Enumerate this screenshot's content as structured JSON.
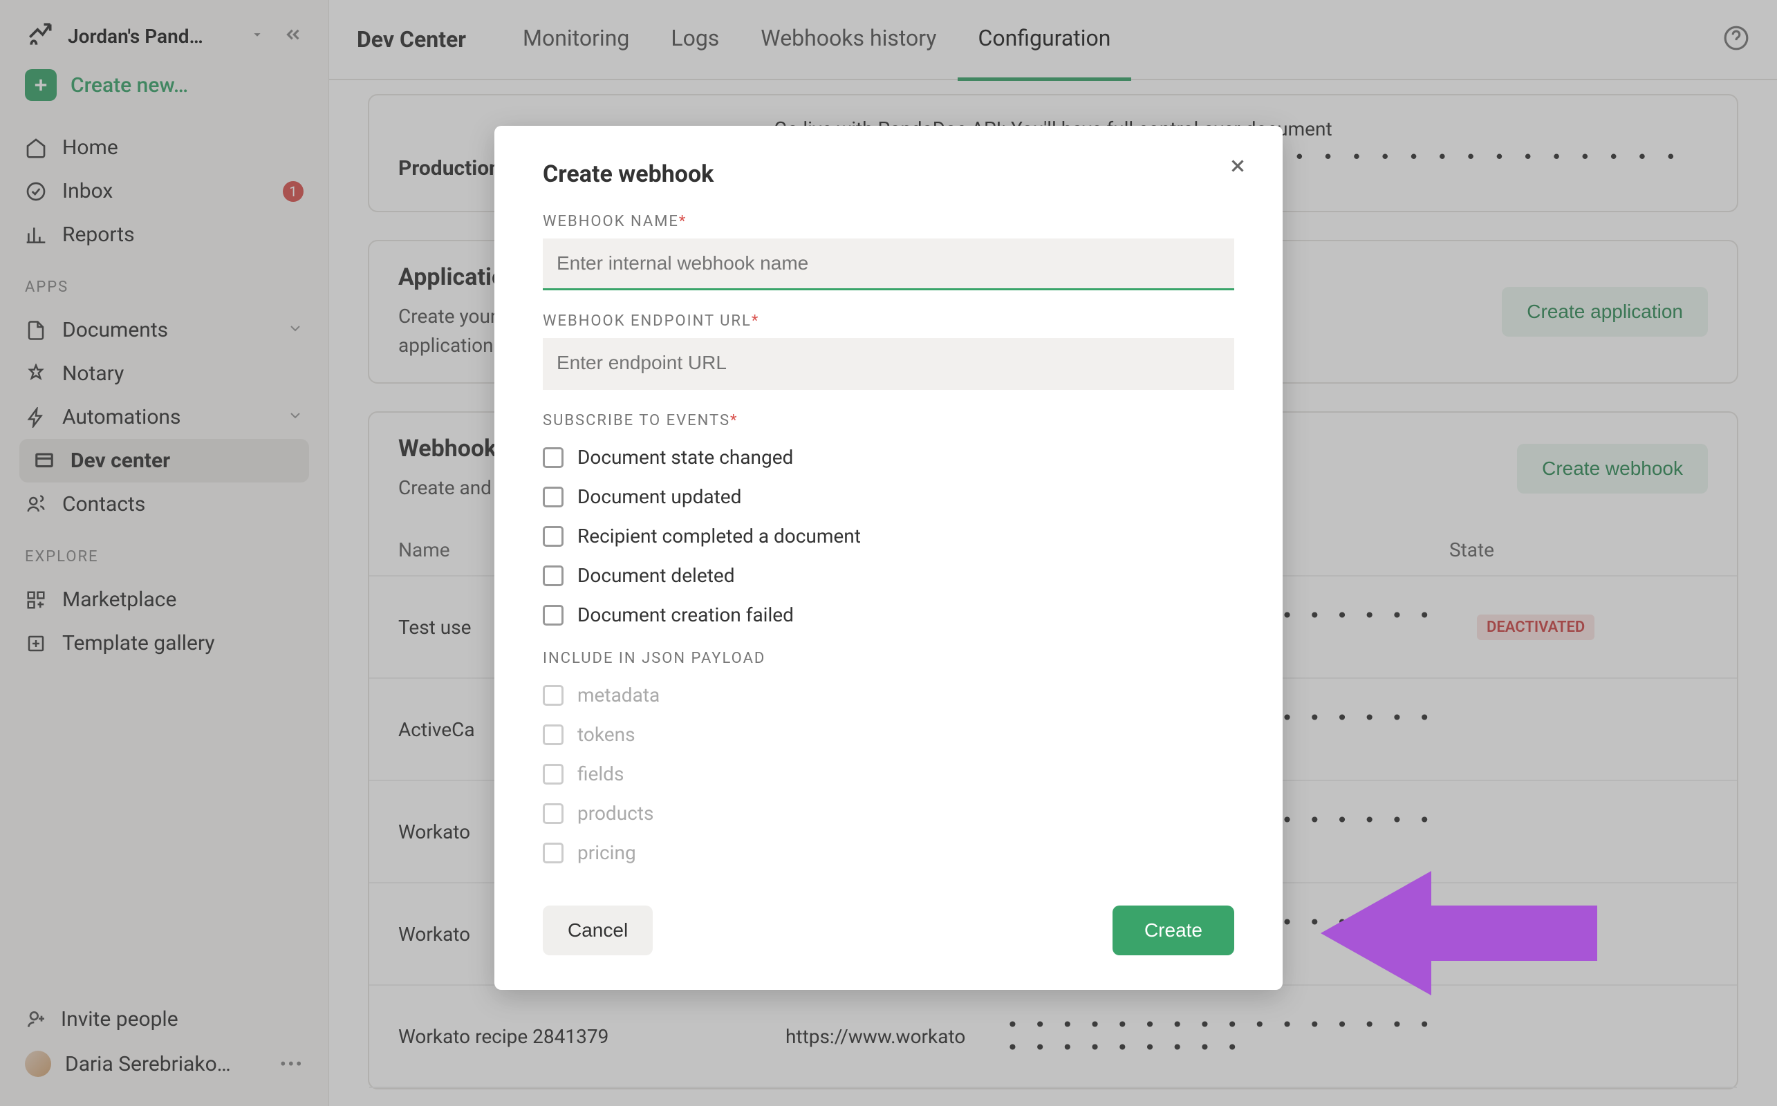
{
  "sidebar": {
    "workspace": "Jordan's Pand…",
    "create_label": "Create new…",
    "nav": {
      "home": "Home",
      "inbox": "Inbox",
      "inbox_badge": "1",
      "reports": "Reports"
    },
    "apps_label": "APPS",
    "apps": {
      "documents": "Documents",
      "notary": "Notary",
      "automations": "Automations",
      "dev_center": "Dev center",
      "contacts": "Contacts"
    },
    "explore_label": "EXPLORE",
    "explore": {
      "marketplace": "Marketplace",
      "template_gallery": "Template gallery"
    },
    "footer": {
      "invite": "Invite people",
      "user": "Daria Serebriako…"
    }
  },
  "topbar": {
    "title": "Dev Center",
    "tabs": {
      "monitoring": "Monitoring",
      "logs": "Logs",
      "webhooks_history": "Webhooks history",
      "configuration": "Configuration"
    }
  },
  "cards": {
    "production": {
      "label": "Production",
      "text": "Go live with PandaDoc API: You'll have full control over document"
    },
    "application": {
      "title": "Application",
      "sub": "Create your own custom app to solve specific use cases each application integrated with your Panda",
      "button": "Create application"
    },
    "webhook": {
      "title": "Webhook",
      "sub": "Create and manage your webhook notification",
      "button": "Create webhook",
      "columns": {
        "name": "Name",
        "state": "State"
      },
      "rows": [
        {
          "name": "Test use",
          "url": "",
          "state_on": false,
          "badge": "DEACTIVATED"
        },
        {
          "name": "ActiveCa",
          "url": "",
          "state_on": true,
          "badge": ""
        },
        {
          "name": "Workato",
          "url": "",
          "state_on": true,
          "badge": ""
        },
        {
          "name": "Workato",
          "url": "",
          "state_on": true,
          "badge": ""
        },
        {
          "name": "Workato recipe 2841379",
          "url": "https://www.workato",
          "state_on": true,
          "badge": ""
        }
      ]
    }
  },
  "modal": {
    "title": "Create webhook",
    "name_label": "WEBHOOK NAME",
    "name_placeholder": "Enter internal webhook name",
    "url_label": "WEBHOOK ENDPOINT URL",
    "url_placeholder": "Enter endpoint URL",
    "events_label": "SUBSCRIBE TO EVENTS",
    "events": [
      "Document state changed",
      "Document updated",
      "Recipient completed a document",
      "Document deleted",
      "Document creation failed"
    ],
    "payload_label": "INCLUDE IN JSON PAYLOAD",
    "payload": [
      "metadata",
      "tokens",
      "fields",
      "products",
      "pricing"
    ],
    "cancel": "Cancel",
    "create": "Create"
  },
  "keydots": "• • • • • • • • • • • • • • • • • • • • • • • • • • • • • • • • • • • • • • • • •",
  "keydots_short": "• • • • • • • • • • • • • • • • • • • • • • • • •"
}
